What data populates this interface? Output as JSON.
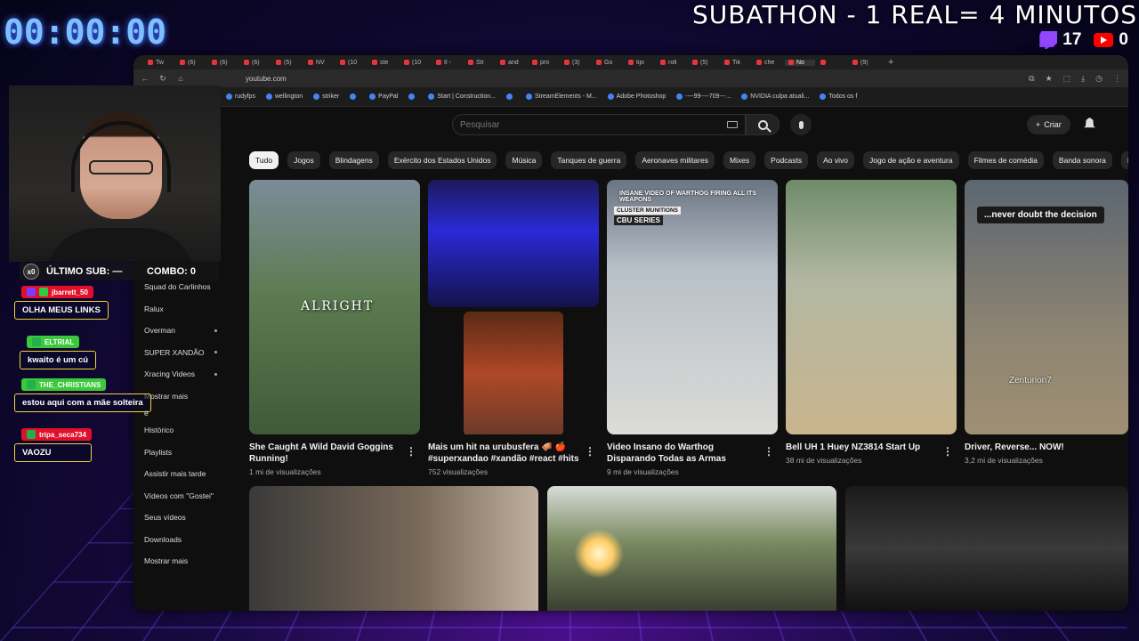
{
  "overlay": {
    "timer": "00:00:00",
    "banner": "SUBATHON - 1 REAL= 4 MINUTOS",
    "twitch_count": "17",
    "youtube_count": "0",
    "last_sub_label": "ÚLTIMO SUB: —",
    "combo_label": "COMBO: 0",
    "multiplier": "x0"
  },
  "chat": [
    {
      "user": "jbarrett_50",
      "text": "OLHA MEUS LINKS",
      "color": "#e0102a"
    },
    {
      "user": "ELTRIAL",
      "text": "kwaito é um cú",
      "color": "#3cc83c"
    },
    {
      "user": "THE_CHRISTIANS",
      "text": "estou aqui com a mãe solteira",
      "color": "#3cc83c"
    },
    {
      "user": "tripa_seca734",
      "text": "VAOZU",
      "color": "#e0102a"
    }
  ],
  "browser": {
    "url": "youtube.com",
    "tabs": [
      "Tw",
      "(6)",
      "(6)",
      "(6)",
      "(5)",
      "NV",
      "(10",
      "ste",
      "(10",
      "Il -",
      "Str",
      "and",
      "pro",
      "(3)",
      "Go",
      "tijo",
      "roll",
      "(5)",
      "Tik",
      "che",
      "No",
      "",
      "(9)"
    ],
    "bookmarks": [
      "rudyfps",
      "wellington",
      "striker",
      "",
      "PayPal",
      "",
      "Start | Construction...",
      "",
      "StreamElements - M...",
      "Adobe Photoshop",
      "----99----709---...",
      "NVIDIA culpa atuali...",
      "Todos os f"
    ]
  },
  "youtube": {
    "search_placeholder": "Pesquisar",
    "create_label": "Criar",
    "chips": [
      "Tudo",
      "Jogos",
      "Blindagens",
      "Exército dos Estados Unidos",
      "Música",
      "Tanques de guerra",
      "Aeronaves militares",
      "Mixes",
      "Podcasts",
      "Ao vivo",
      "Jogo de ação e aventura",
      "Filmes de comédia",
      "Banda sonora",
      "En"
    ],
    "sidebar": [
      {
        "label": "Squad do Carlinhos",
        "dot": false
      },
      {
        "label": "Ralux",
        "dot": false
      },
      {
        "label": "Overman",
        "dot": true
      },
      {
        "label": "SUPER XANDÃO",
        "dot": true
      },
      {
        "label": "Xracing Videos",
        "dot": true
      },
      {
        "label": "Mostrar mais",
        "dot": false
      }
    ],
    "sidebar_section": "ê",
    "sidebar_you": [
      "Histórico",
      "Playlists",
      "Assistir mais tarde",
      "Vídeos com \"Gostei\"",
      "Seus vídeos",
      "Downloads",
      "Mostrar mais"
    ],
    "videos": [
      {
        "title": "She Caught A Wild David Goggins Running!",
        "views": "1 mi de visualizações",
        "overlay": "ALRIGHT"
      },
      {
        "title": "Mais um hit na urubusfera 🪗 🍎 #superxandao #xandão #react #hits",
        "views": "752 visualizações"
      },
      {
        "title": "Video Insano do Warthog Disparando Todas as Armas",
        "views": "9 mi de visualizações",
        "tag1": "INSANE VIDEO OF WARTHOG FIRING ALL ITS WEAPONS",
        "tag2": "CLUSTER MUNITIONS",
        "tag3": "CBU SERIES"
      },
      {
        "title": "Bell UH 1 Huey NZ3814 Start Up",
        "views": "38 mi de visualizações"
      },
      {
        "title": "Driver, Reverse... NOW!",
        "views": "3,2 mi de visualizações",
        "overlay": "...never doubt the decision",
        "watermark": "Zenturion7"
      }
    ]
  }
}
